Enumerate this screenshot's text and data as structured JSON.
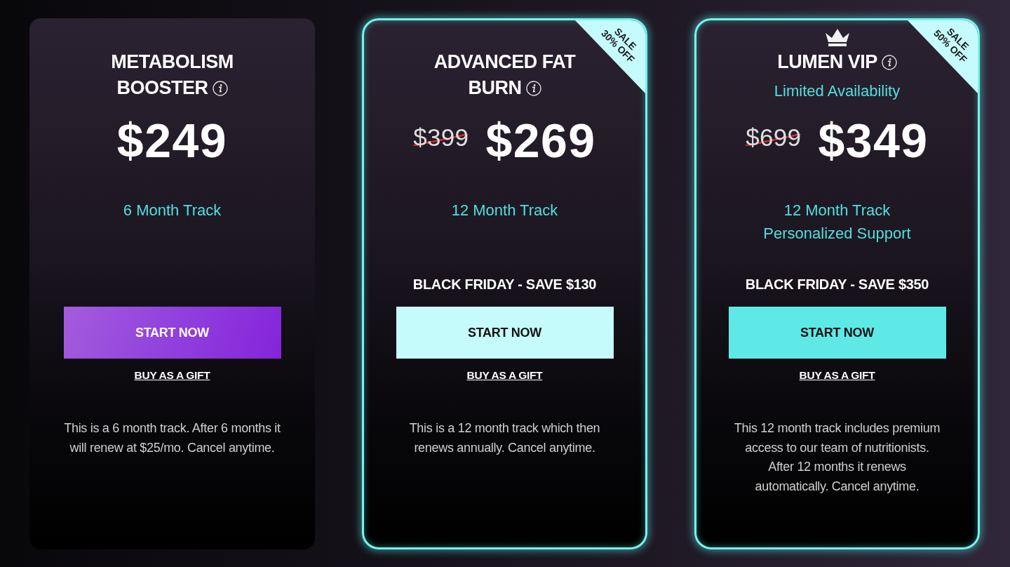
{
  "plans": [
    {
      "title": [
        "METABOLISM",
        "BOOSTER"
      ],
      "featured": false,
      "crown_badge": false,
      "price": "$249",
      "track": [
        "6 Month Track"
      ],
      "button": {
        "label": "START NOW",
        "kind": "gradient"
      },
      "gift_link": "BUY AS A GIFT",
      "description": "This is a 6 month track. After 6 months it\nwill renew at $25/mo. Cancel anytime."
    },
    {
      "title": [
        "ADVANCED FAT",
        "BURN"
      ],
      "featured": true,
      "crown_badge": false,
      "sale_badge": "SALE\n30% OFF",
      "old_price": "$399",
      "price": "$269",
      "track": [
        "12 Month Track"
      ],
      "promo": "BLACK FRIDAY - SAVE $130",
      "button": {
        "label": "START NOW",
        "kind": "pale"
      },
      "gift_link": "BUY AS A GIFT",
      "description": "This is a 12 month track which then\nrenews annually. Cancel anytime."
    },
    {
      "title": [
        "LUMEN VIP"
      ],
      "featured": true,
      "crown_badge": true,
      "sale_badge": "SALE\n50% OFF",
      "subtitle": "Limited Availability",
      "old_price": "$699",
      "price": "$349",
      "track": [
        "12 Month Track",
        "Personalized Support"
      ],
      "promo": "BLACK FRIDAY - SAVE $350",
      "button": {
        "label": "START NOW",
        "kind": "bright"
      },
      "gift_link": "BUY AS A GIFT",
      "description": "This 12 month track includes premium\naccess to our team of nutritionists.\nAfter 12 months it renews\nautomatically. Cancel anytime."
    }
  ]
}
